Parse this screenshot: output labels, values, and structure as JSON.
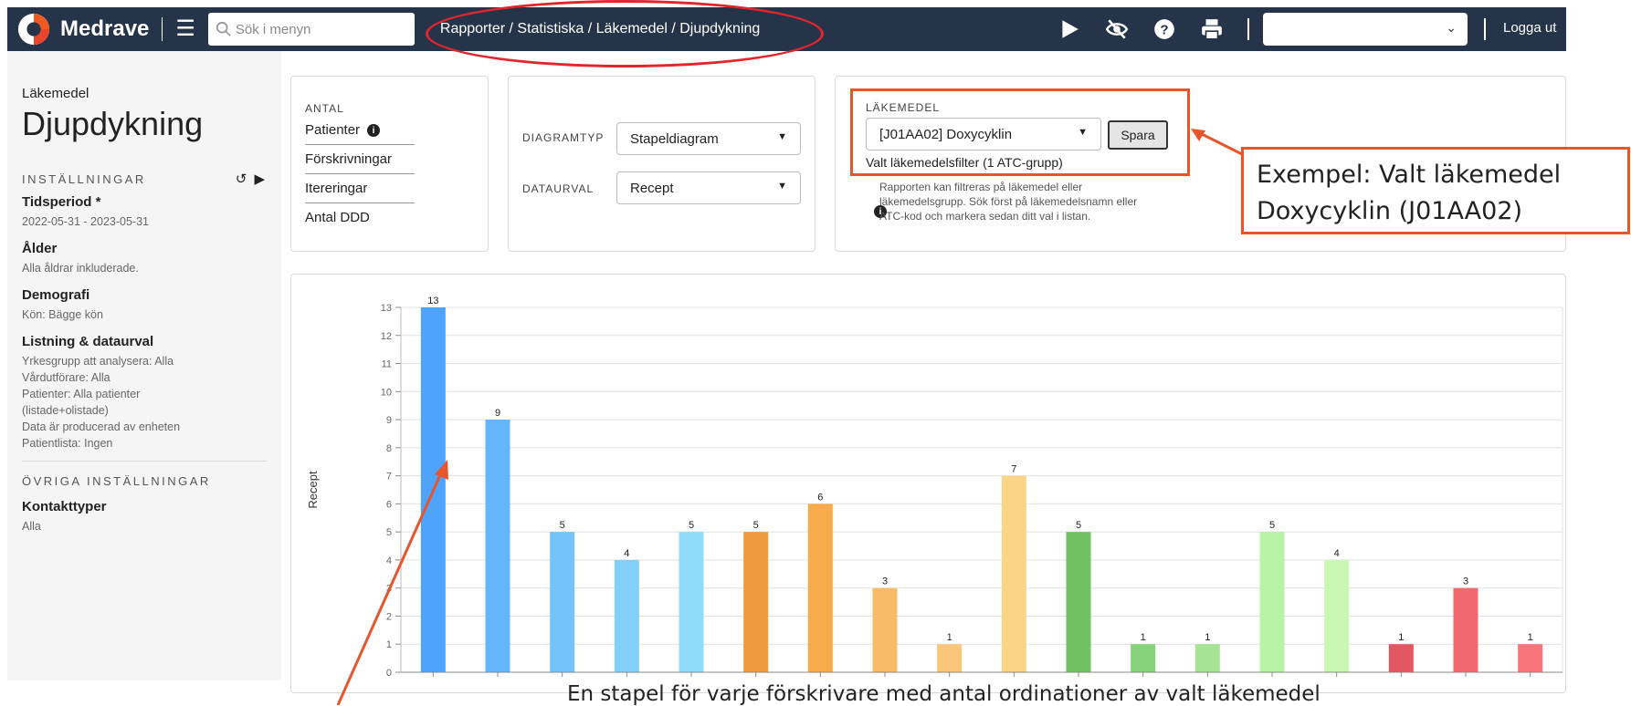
{
  "app": {
    "name": "Medrave",
    "search_placeholder": "Sök i menyn",
    "breadcrumb": "Rapporter / Statistiska / Läkemedel / Djupdykning",
    "unit_select_value": "",
    "logout": "Logga ut",
    "icons": [
      "play-icon",
      "eye-off-icon",
      "help-icon",
      "print-icon"
    ]
  },
  "sidebar": {
    "category": "Läkemedel",
    "title": "Djupdykning",
    "settings_label": "INSTÄLLNINGAR",
    "settings_controls": "↺ ▶",
    "items": [
      {
        "label": "Tidsperiod *",
        "values": [
          "2022-05-31 - 2023-05-31"
        ]
      },
      {
        "label": "Ålder",
        "values": [
          "Alla åldrar inkluderade."
        ]
      },
      {
        "label": "Demografi",
        "values": [
          "Kön: Bägge kön"
        ]
      },
      {
        "label": "Listning & dataurval",
        "values": [
          "Yrkesgrupp att analysera: Alla",
          "Vårdutförare: Alla",
          "Patienter: Alla patienter",
          "(listade+olistade)",
          "Data är producerad av enheten",
          "Patientlista: Ingen"
        ]
      }
    ],
    "other_label": "ÖVRIGA INSTÄLLNINGAR",
    "contact": {
      "label": "Kontakttyper",
      "value": "Alla"
    }
  },
  "antal": {
    "label": "ANTAL",
    "items": [
      "Patienter",
      "Förskrivningar",
      "Itereringar",
      "Antal DDD"
    ]
  },
  "diagram": {
    "type_label": "DIAGRAMTYP",
    "type_value": "Stapeldiagram",
    "dataurval_label": "DATAURVAL",
    "dataurval_value": "Recept"
  },
  "lakemedel": {
    "label": "LÄKEMEDEL",
    "value": "[J01AA02] Doxycyklin",
    "save": "Spara",
    "filter_text": "Valt läkemedelsfilter (1 ATC-grupp)",
    "info_lines": [
      "Rapporten kan filtreras på läkemedel eller",
      "läkemedelsgrupp. Sök först på läkemedelsnamn eller",
      "ATC-kod och markera sedan ditt val i listan."
    ]
  },
  "annotations": {
    "callout_line1": "Exempel: Valt läkemedel",
    "callout_line2": "Doxycyklin (J01AA02)",
    "caption": "En stapel för varje förskrivare med antal ordinationer av valt läkemedel",
    "color": "#e7552c",
    "ellipse_color": "#e3242b"
  },
  "chart_data": {
    "type": "bar",
    "ylabel": "Recept",
    "ylim": [
      0,
      13
    ],
    "yticks": [
      0,
      1,
      2,
      3,
      4,
      5,
      6,
      7,
      8,
      9,
      10,
      11,
      12,
      13
    ],
    "values": [
      13,
      9,
      5,
      4,
      5,
      5,
      6,
      3,
      1,
      7,
      5,
      1,
      1,
      5,
      4,
      1,
      3,
      1
    ],
    "colors": [
      "#4ea3fb",
      "#64b5f9",
      "#74c4fa",
      "#82d0fa",
      "#8fdcfa",
      "#ef9a3f",
      "#f7ab4d",
      "#f8bb68",
      "#fac77a",
      "#fcd485",
      "#6fc161",
      "#85d27a",
      "#a6e392",
      "#b9f3a5",
      "#c9f8b4",
      "#e35762",
      "#f0696f",
      "#f8767b"
    ]
  }
}
